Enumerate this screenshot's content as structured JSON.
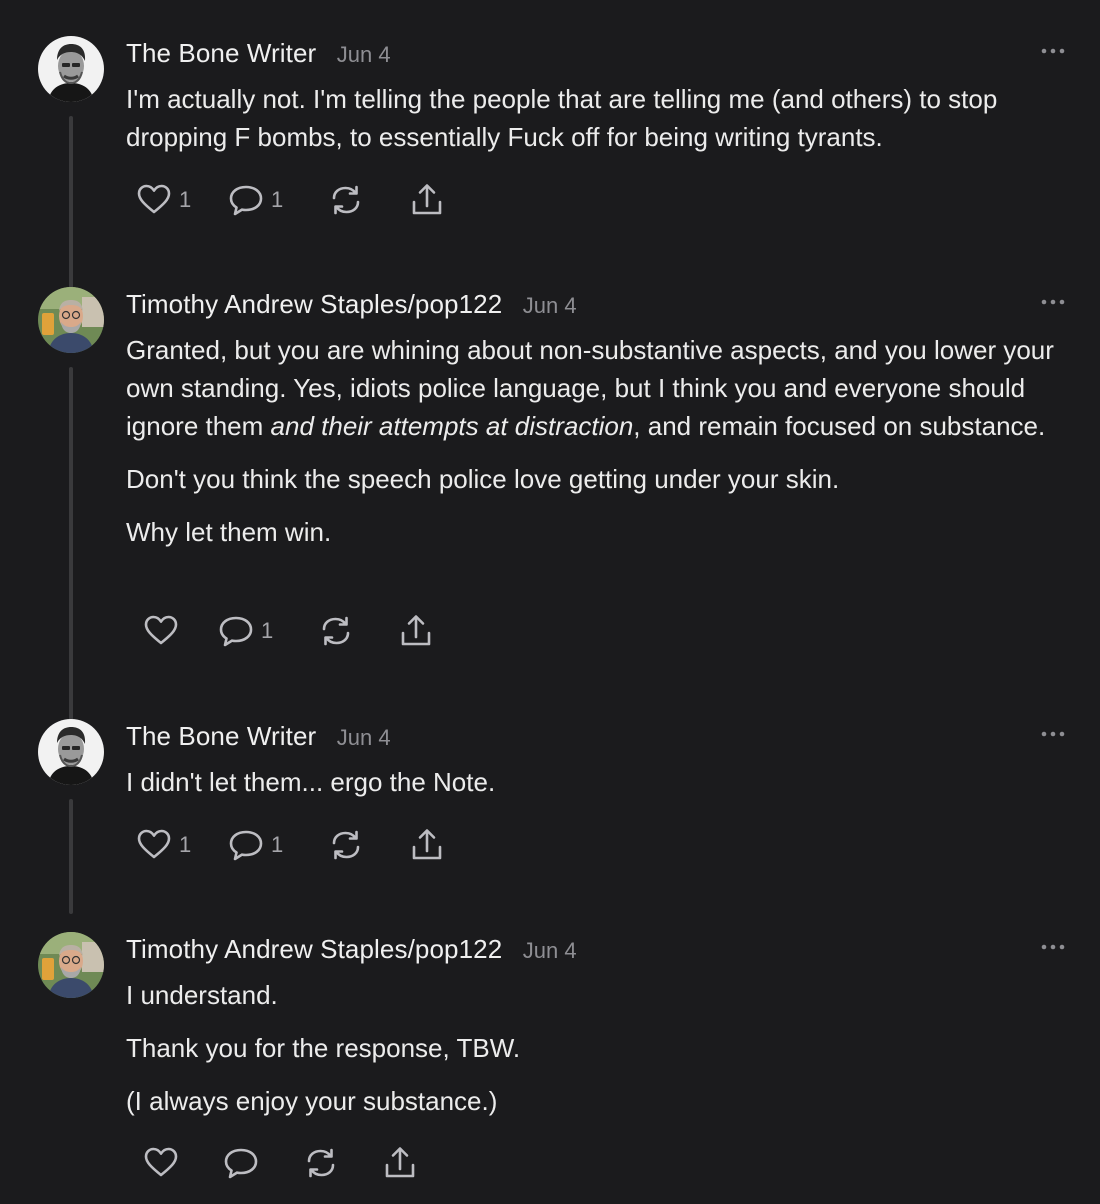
{
  "comments": [
    {
      "author": "The Bone Writer",
      "date": "Jun 4",
      "avatar": "bone-writer-avatar",
      "paragraphs": [
        "I'm actually not. I'm telling the people that are telling me (and others) to stop dropping F bombs, to essentially Fuck off for being writing tyrants."
      ],
      "like_count": "1",
      "reply_count": "1"
    },
    {
      "author": "Timothy Andrew Staples/pop122",
      "date": "Jun 4",
      "avatar": "timothy-avatar",
      "paragraph_1_a": "Granted, but you are whining about non-substantive aspects, and you lower your own standing. Yes, idiots police language, but I think you and everyone should ignore them ",
      "paragraph_1_em": "and their attempts at distraction",
      "paragraph_1_b": ", and remain focused on substance.",
      "paragraphs": [
        "Don't you think the speech police love getting under your skin.",
        "Why let them win."
      ],
      "like_count": "",
      "reply_count": "1"
    },
    {
      "author": "The Bone Writer",
      "date": "Jun 4",
      "avatar": "bone-writer-avatar",
      "paragraphs": [
        "I didn't let them... ergo the Note."
      ],
      "like_count": "1",
      "reply_count": "1"
    },
    {
      "author": "Timothy Andrew Staples/pop122",
      "date": "Jun 4",
      "avatar": "timothy-avatar",
      "paragraphs": [
        "I understand.",
        "Thank you for the response, TBW.",
        "(I always enjoy your substance.)"
      ],
      "like_count": "",
      "reply_count": ""
    }
  ],
  "icons": {
    "like": "heart-icon",
    "reply": "comment-bubble-icon",
    "restack": "restack-icon",
    "share": "share-icon",
    "more": "more-dots-icon"
  },
  "colors": {
    "background": "#1b1b1d",
    "text": "#ececec",
    "muted": "#8e8e93",
    "thread_line": "#3a3a3c"
  }
}
